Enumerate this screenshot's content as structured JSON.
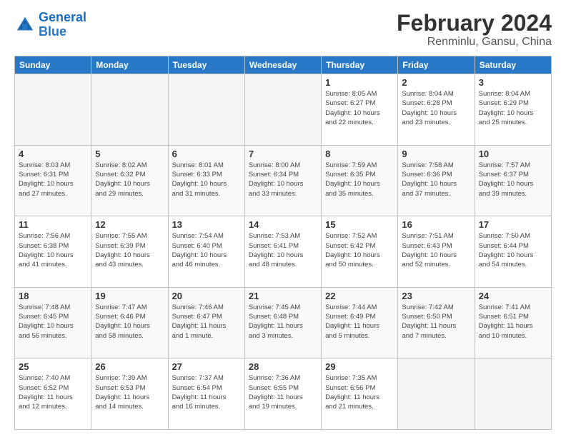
{
  "logo": {
    "line1": "General",
    "line2": "Blue"
  },
  "title": "February 2024",
  "subtitle": "Renminlu, Gansu, China",
  "days_header": [
    "Sunday",
    "Monday",
    "Tuesday",
    "Wednesday",
    "Thursday",
    "Friday",
    "Saturday"
  ],
  "weeks": [
    [
      {
        "day": "",
        "info": ""
      },
      {
        "day": "",
        "info": ""
      },
      {
        "day": "",
        "info": ""
      },
      {
        "day": "",
        "info": ""
      },
      {
        "day": "1",
        "info": "Sunrise: 8:05 AM\nSunset: 6:27 PM\nDaylight: 10 hours\nand 22 minutes."
      },
      {
        "day": "2",
        "info": "Sunrise: 8:04 AM\nSunset: 6:28 PM\nDaylight: 10 hours\nand 23 minutes."
      },
      {
        "day": "3",
        "info": "Sunrise: 8:04 AM\nSunset: 6:29 PM\nDaylight: 10 hours\nand 25 minutes."
      }
    ],
    [
      {
        "day": "4",
        "info": "Sunrise: 8:03 AM\nSunset: 6:31 PM\nDaylight: 10 hours\nand 27 minutes."
      },
      {
        "day": "5",
        "info": "Sunrise: 8:02 AM\nSunset: 6:32 PM\nDaylight: 10 hours\nand 29 minutes."
      },
      {
        "day": "6",
        "info": "Sunrise: 8:01 AM\nSunset: 6:33 PM\nDaylight: 10 hours\nand 31 minutes."
      },
      {
        "day": "7",
        "info": "Sunrise: 8:00 AM\nSunset: 6:34 PM\nDaylight: 10 hours\nand 33 minutes."
      },
      {
        "day": "8",
        "info": "Sunrise: 7:59 AM\nSunset: 6:35 PM\nDaylight: 10 hours\nand 35 minutes."
      },
      {
        "day": "9",
        "info": "Sunrise: 7:58 AM\nSunset: 6:36 PM\nDaylight: 10 hours\nand 37 minutes."
      },
      {
        "day": "10",
        "info": "Sunrise: 7:57 AM\nSunset: 6:37 PM\nDaylight: 10 hours\nand 39 minutes."
      }
    ],
    [
      {
        "day": "11",
        "info": "Sunrise: 7:56 AM\nSunset: 6:38 PM\nDaylight: 10 hours\nand 41 minutes."
      },
      {
        "day": "12",
        "info": "Sunrise: 7:55 AM\nSunset: 6:39 PM\nDaylight: 10 hours\nand 43 minutes."
      },
      {
        "day": "13",
        "info": "Sunrise: 7:54 AM\nSunset: 6:40 PM\nDaylight: 10 hours\nand 46 minutes."
      },
      {
        "day": "14",
        "info": "Sunrise: 7:53 AM\nSunset: 6:41 PM\nDaylight: 10 hours\nand 48 minutes."
      },
      {
        "day": "15",
        "info": "Sunrise: 7:52 AM\nSunset: 6:42 PM\nDaylight: 10 hours\nand 50 minutes."
      },
      {
        "day": "16",
        "info": "Sunrise: 7:51 AM\nSunset: 6:43 PM\nDaylight: 10 hours\nand 52 minutes."
      },
      {
        "day": "17",
        "info": "Sunrise: 7:50 AM\nSunset: 6:44 PM\nDaylight: 10 hours\nand 54 minutes."
      }
    ],
    [
      {
        "day": "18",
        "info": "Sunrise: 7:48 AM\nSunset: 6:45 PM\nDaylight: 10 hours\nand 56 minutes."
      },
      {
        "day": "19",
        "info": "Sunrise: 7:47 AM\nSunset: 6:46 PM\nDaylight: 10 hours\nand 58 minutes."
      },
      {
        "day": "20",
        "info": "Sunrise: 7:46 AM\nSunset: 6:47 PM\nDaylight: 11 hours\nand 1 minute."
      },
      {
        "day": "21",
        "info": "Sunrise: 7:45 AM\nSunset: 6:48 PM\nDaylight: 11 hours\nand 3 minutes."
      },
      {
        "day": "22",
        "info": "Sunrise: 7:44 AM\nSunset: 6:49 PM\nDaylight: 11 hours\nand 5 minutes."
      },
      {
        "day": "23",
        "info": "Sunrise: 7:42 AM\nSunset: 6:50 PM\nDaylight: 11 hours\nand 7 minutes."
      },
      {
        "day": "24",
        "info": "Sunrise: 7:41 AM\nSunset: 6:51 PM\nDaylight: 11 hours\nand 10 minutes."
      }
    ],
    [
      {
        "day": "25",
        "info": "Sunrise: 7:40 AM\nSunset: 6:52 PM\nDaylight: 11 hours\nand 12 minutes."
      },
      {
        "day": "26",
        "info": "Sunrise: 7:39 AM\nSunset: 6:53 PM\nDaylight: 11 hours\nand 14 minutes."
      },
      {
        "day": "27",
        "info": "Sunrise: 7:37 AM\nSunset: 6:54 PM\nDaylight: 11 hours\nand 16 minutes."
      },
      {
        "day": "28",
        "info": "Sunrise: 7:36 AM\nSunset: 6:55 PM\nDaylight: 11 hours\nand 19 minutes."
      },
      {
        "day": "29",
        "info": "Sunrise: 7:35 AM\nSunset: 6:56 PM\nDaylight: 11 hours\nand 21 minutes."
      },
      {
        "day": "",
        "info": ""
      },
      {
        "day": "",
        "info": ""
      }
    ]
  ]
}
